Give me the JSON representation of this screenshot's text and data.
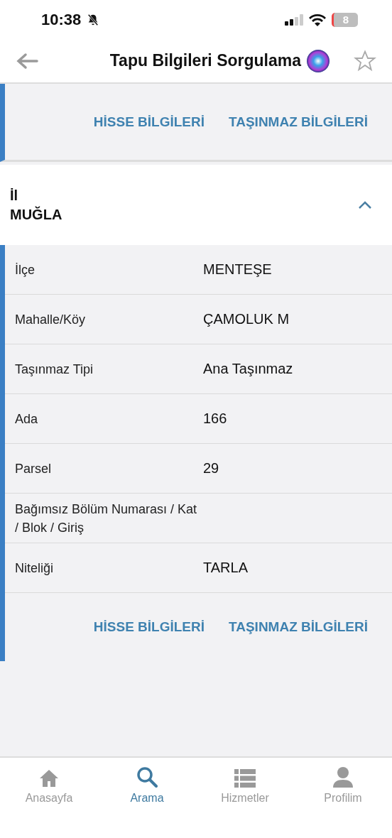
{
  "status_bar": {
    "time": "10:38",
    "battery": "8"
  },
  "nav": {
    "title": "Tapu Bilgileri Sorgulama",
    "favorite": false
  },
  "top_actions": [
    "HİSSE BİLGİLERİ",
    "TAŞINMAZ BİLGİLERİ"
  ],
  "section": {
    "label": "İl",
    "value": "MUĞLA",
    "expanded": true
  },
  "rows": [
    {
      "label": "İlçe",
      "value": "MENTEŞE"
    },
    {
      "label": "Mahalle/Köy",
      "value": "ÇAMOLUK M"
    },
    {
      "label": "Taşınmaz Tipi",
      "value": "Ana Taşınmaz"
    },
    {
      "label": "Ada",
      "value": "166"
    },
    {
      "label": "Parsel",
      "value": "29"
    },
    {
      "label": "Bağımsız Bölüm Numarası / Kat / Blok / Giriş"
    },
    {
      "label": "Niteliği",
      "value": "TARLA"
    }
  ],
  "bottom_actions": [
    "HİSSE BİLGİLERİ",
    "TAŞINMAZ BİLGİLERİ"
  ],
  "tabs": [
    {
      "kind": "home",
      "label": "Anasayfa",
      "selected": false
    },
    {
      "kind": "search",
      "label": "Arama",
      "selected": true
    },
    {
      "kind": "list",
      "label": "Hizmetler",
      "selected": false
    },
    {
      "kind": "person",
      "label": "Profilim",
      "selected": false
    }
  ]
}
